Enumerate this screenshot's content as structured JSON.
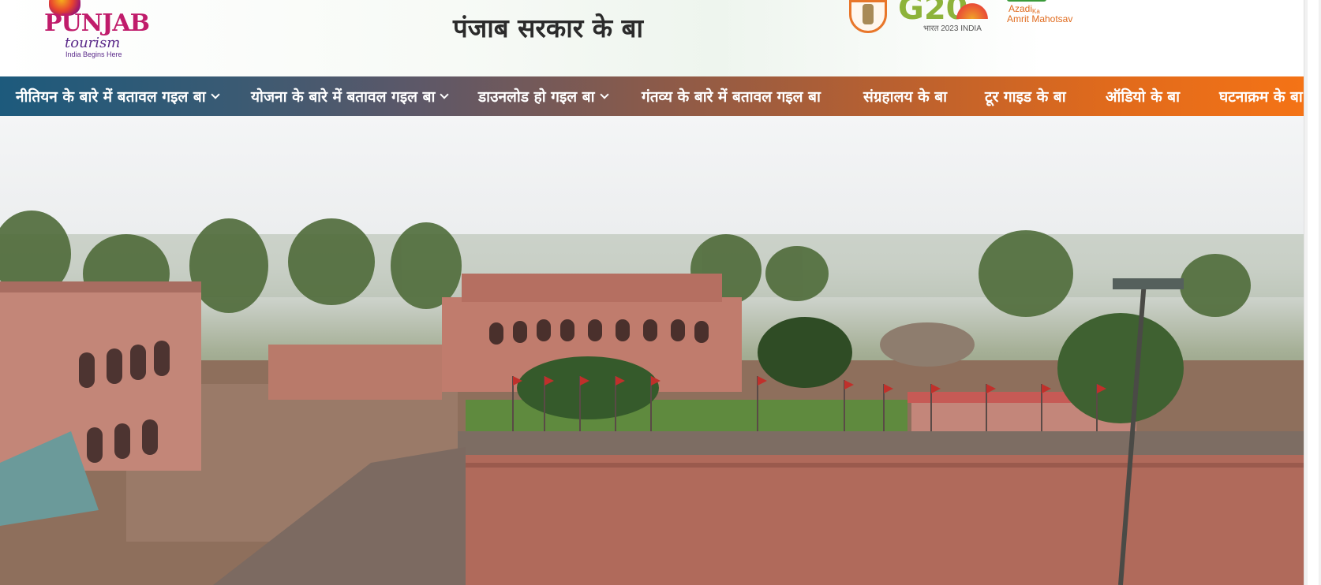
{
  "header": {
    "title": "पंजाब सरकार के बा",
    "logo": {
      "name": "PUNJAB",
      "subtitle": "tourism",
      "tagline": "India Begins Here"
    },
    "partner_logos": {
      "emblem": "state-emblem-icon",
      "g20_text": "G20",
      "g20_sub": "भारत 2023 INDIA",
      "azadi_line1": "Azadi",
      "azadi_ka": "Ka",
      "azadi_line2": "Amrit Mahotsav"
    }
  },
  "nav": {
    "items": [
      {
        "label": "नीतियन के बारे में बतावल गइल बा",
        "dropdown": true
      },
      {
        "label": "योजना के बारे में बतावल गइल बा",
        "dropdown": true
      },
      {
        "label": "डाउनलोड हो गइल बा",
        "dropdown": true
      },
      {
        "label": "गंतव्य के बारे में बतावल गइल बा",
        "dropdown": false
      },
      {
        "label": "संग्रहालय के बा",
        "dropdown": false
      },
      {
        "label": "टूर गाइड के बा",
        "dropdown": false
      },
      {
        "label": "ऑडियो के बा",
        "dropdown": false
      },
      {
        "label": "घटनाक्रम के बा",
        "dropdown": false
      }
    ],
    "gradient": [
      "#1d5a7c",
      "#f47316"
    ]
  },
  "hero": {
    "scene": "fort-aerial-view-image"
  }
}
